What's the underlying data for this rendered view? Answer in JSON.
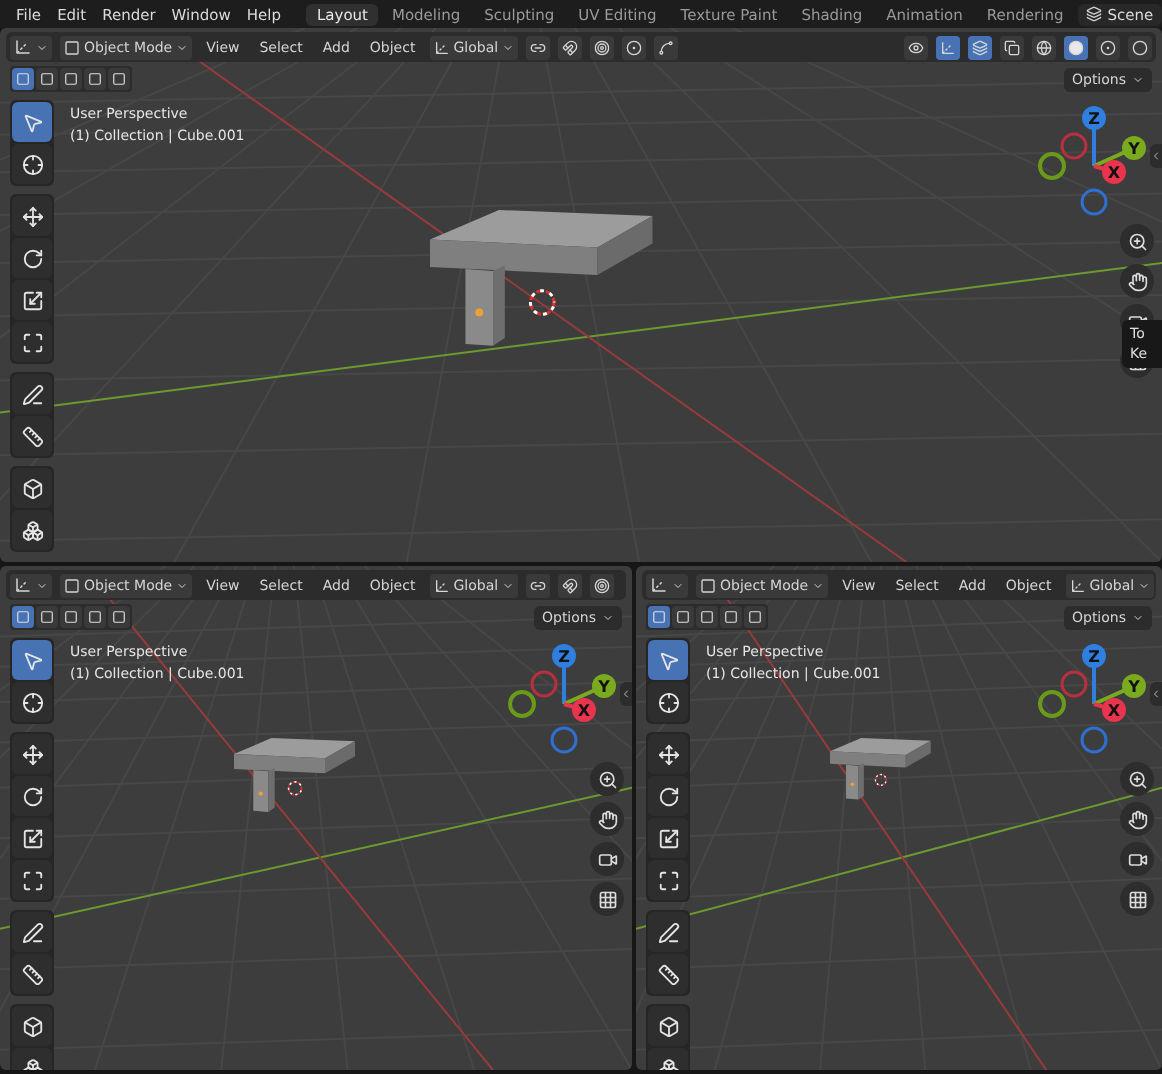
{
  "menu_bar": {
    "menus": [
      "File",
      "Edit",
      "Render",
      "Window",
      "Help"
    ],
    "workspaces": [
      {
        "label": "Layout",
        "selected": true
      },
      {
        "label": "Modeling",
        "selected": false
      },
      {
        "label": "Sculpting",
        "selected": false
      },
      {
        "label": "UV Editing",
        "selected": false
      },
      {
        "label": "Texture Paint",
        "selected": false
      },
      {
        "label": "Shading",
        "selected": false
      },
      {
        "label": "Animation",
        "selected": false
      },
      {
        "label": "Rendering",
        "selected": false
      }
    ],
    "scene": "Scene"
  },
  "viewports": [
    {
      "mode": "Object Mode",
      "menus": [
        "View",
        "Select",
        "Add",
        "Object"
      ],
      "orientation": "Global",
      "left_tools": [
        {
          "kind": "pivot"
        },
        {
          "kind": "snap"
        },
        {
          "kind": "snap-target"
        },
        {
          "kind": "proportional"
        },
        {
          "kind": "falloff"
        }
      ],
      "right_tools": [
        {
          "kind": "visibility",
          "selected": false
        },
        {
          "kind": "gizmos",
          "selected": true
        },
        {
          "kind": "overlays",
          "selected": true
        },
        {
          "kind": "xray",
          "selected": false
        }
      ],
      "shading": [
        {
          "kind": "wireframe",
          "selected": false
        },
        {
          "kind": "solid",
          "selected": true
        },
        {
          "kind": "material",
          "selected": false
        },
        {
          "kind": "rendered",
          "selected": false
        }
      ],
      "select_modes": [
        {
          "selected": true
        },
        {
          "selected": false
        },
        {
          "selected": false
        },
        {
          "selected": false
        },
        {
          "selected": false
        }
      ],
      "options": "Options",
      "overlay": [
        "User Perspective",
        "(1) Collection | Cube.001"
      ],
      "tool_groups": [
        [
          {
            "kind": "select",
            "selected": true
          },
          {
            "kind": "cursor",
            "selected": false
          }
        ],
        [
          {
            "kind": "move",
            "selected": false
          },
          {
            "kind": "rotate",
            "selected": false
          },
          {
            "kind": "scale",
            "selected": false
          },
          {
            "kind": "transform",
            "selected": false
          }
        ],
        [
          {
            "kind": "annotate",
            "selected": false
          },
          {
            "kind": "measure",
            "selected": false
          }
        ],
        [
          {
            "kind": "add-cube",
            "selected": false
          },
          {
            "kind": "transform-cube",
            "selected": false
          }
        ]
      ],
      "gizmo": {
        "x": "X",
        "y": "Y",
        "z": "Z"
      },
      "tooltip": [
        "To",
        "Ke"
      ]
    },
    {
      "mode": "Object Mode",
      "menus": [
        "View",
        "Select",
        "Add",
        "Object"
      ],
      "orientation": "Global",
      "left_tools": [
        {
          "kind": "pivot"
        },
        {
          "kind": "snap"
        },
        {
          "kind": "snap-target"
        }
      ],
      "select_modes": [
        {
          "selected": true
        },
        {
          "selected": false
        },
        {
          "selected": false
        },
        {
          "selected": false
        },
        {
          "selected": false
        }
      ],
      "options": "Options",
      "overlay": [
        "User Perspective",
        "(1) Collection | Cube.001"
      ],
      "tool_groups": [
        [
          {
            "kind": "select",
            "selected": true
          },
          {
            "kind": "cursor",
            "selected": false
          }
        ],
        [
          {
            "kind": "move",
            "selected": false
          },
          {
            "kind": "rotate",
            "selected": false
          },
          {
            "kind": "scale",
            "selected": false
          },
          {
            "kind": "transform",
            "selected": false
          }
        ],
        [
          {
            "kind": "annotate",
            "selected": false
          },
          {
            "kind": "measure",
            "selected": false
          }
        ],
        [
          {
            "kind": "add-cube",
            "selected": false
          },
          {
            "kind": "transform-cube",
            "selected": false
          }
        ]
      ],
      "gizmo": {
        "x": "X",
        "y": "Y",
        "z": "Z"
      }
    },
    {
      "mode": "Object Mode",
      "menus": [
        "View",
        "Select",
        "Add",
        "Object"
      ],
      "orientation": "Global",
      "select_modes": [
        {
          "selected": true
        },
        {
          "selected": false
        },
        {
          "selected": false
        },
        {
          "selected": false
        },
        {
          "selected": false
        }
      ],
      "options": "Options",
      "overlay": [
        "User Perspective",
        "(1) Collection | Cube.001"
      ],
      "tool_groups": [
        [
          {
            "kind": "select",
            "selected": true
          },
          {
            "kind": "cursor",
            "selected": false
          }
        ],
        [
          {
            "kind": "move",
            "selected": false
          },
          {
            "kind": "rotate",
            "selected": false
          },
          {
            "kind": "scale",
            "selected": false
          },
          {
            "kind": "transform",
            "selected": false
          }
        ],
        [
          {
            "kind": "annotate",
            "selected": false
          },
          {
            "kind": "measure",
            "selected": false
          }
        ],
        [
          {
            "kind": "add-cube",
            "selected": false
          },
          {
            "kind": "transform-cube",
            "selected": false
          }
        ]
      ],
      "gizmo": {
        "x": "X",
        "y": "Y",
        "z": "Z"
      }
    }
  ]
}
